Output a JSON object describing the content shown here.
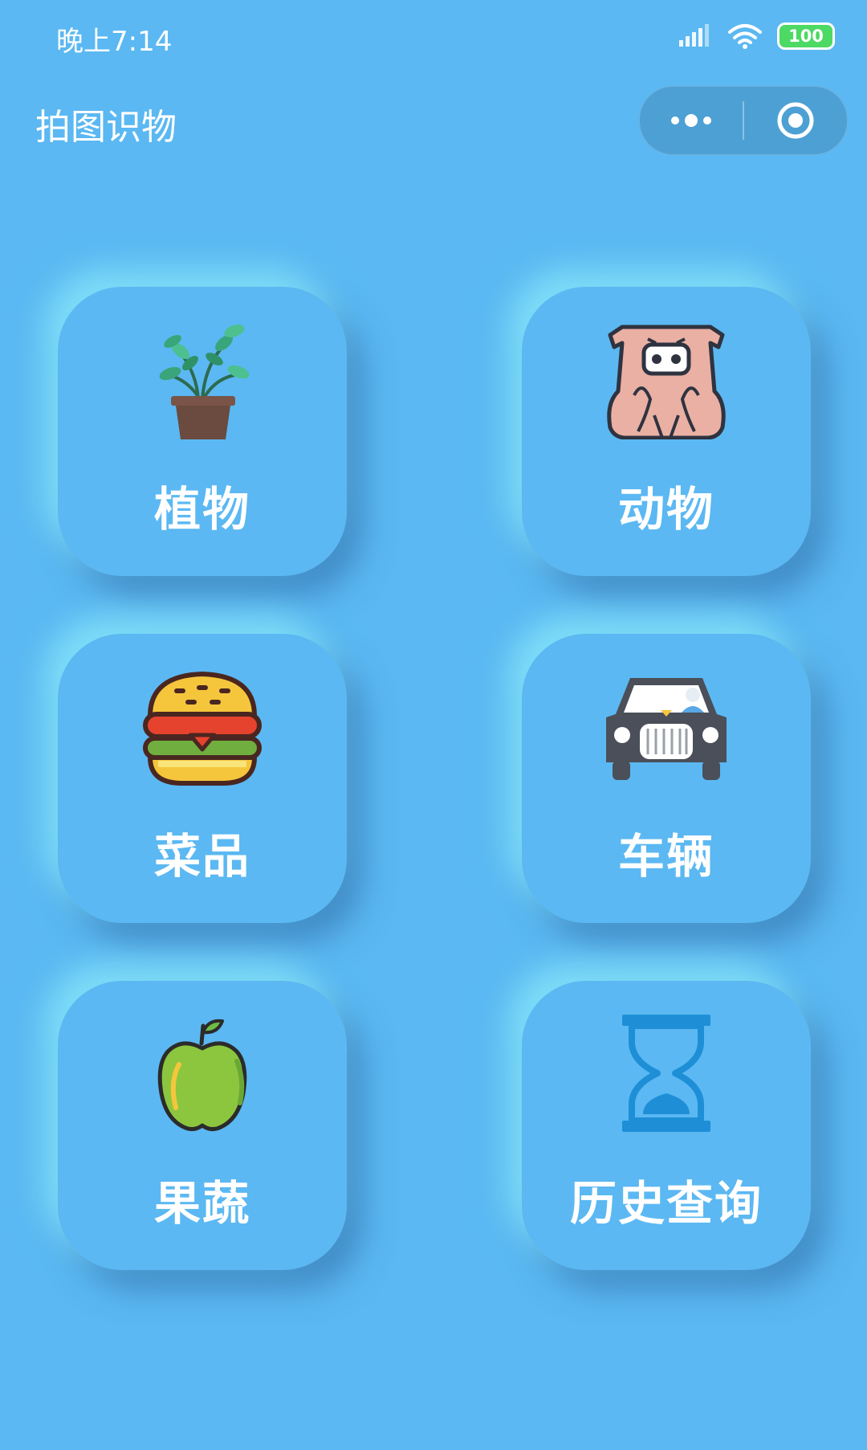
{
  "status_bar": {
    "time": "晚上7:14",
    "battery": "100"
  },
  "nav": {
    "title": "拍图识物"
  },
  "cards": [
    {
      "label": "植物",
      "icon": "potted-plant-icon"
    },
    {
      "label": "动物",
      "icon": "pig-icon"
    },
    {
      "label": "菜品",
      "icon": "burger-icon"
    },
    {
      "label": "车辆",
      "icon": "car-icon"
    },
    {
      "label": "果蔬",
      "icon": "apple-icon"
    },
    {
      "label": "历史查询",
      "icon": "hourglass-icon"
    }
  ],
  "colors": {
    "background": "#5bb8f2",
    "text": "#ffffff",
    "battery": "#4cd964"
  }
}
